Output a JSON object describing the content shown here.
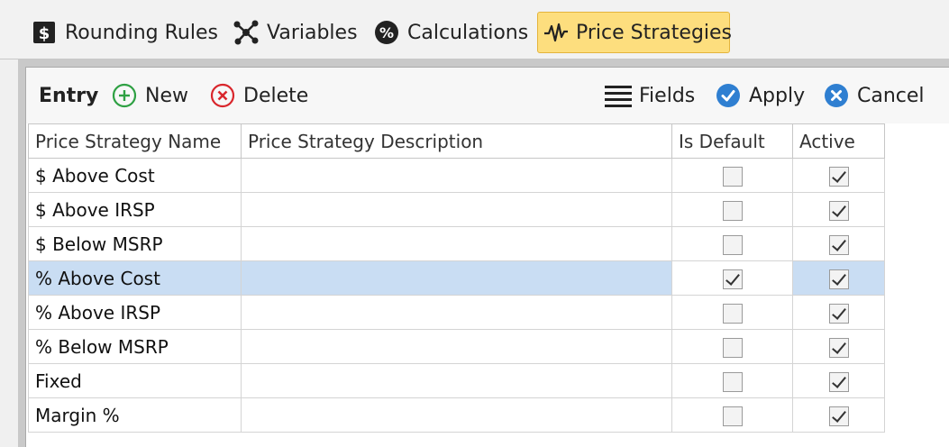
{
  "tabs": [
    {
      "label": "Rounding Rules",
      "icon": "dollar-sign-icon",
      "active": false
    },
    {
      "label": "Variables",
      "icon": "network-nodes-icon",
      "active": false
    },
    {
      "label": "Calculations",
      "icon": "percent-icon",
      "active": false
    },
    {
      "label": "Price Strategies",
      "icon": "pulse-wave-icon",
      "active": true
    }
  ],
  "toolbar": {
    "title": "Entry",
    "new_label": "New",
    "delete_label": "Delete",
    "fields_label": "Fields",
    "apply_label": "Apply",
    "cancel_label": "Cancel"
  },
  "grid": {
    "columns": [
      "Price Strategy Name",
      "Price Strategy Description",
      "Is Default",
      "Active"
    ],
    "rows": [
      {
        "name": "$ Above Cost",
        "description": "",
        "is_default": false,
        "active": true
      },
      {
        "name": "$ Above IRSP",
        "description": "",
        "is_default": false,
        "active": true
      },
      {
        "name": "$ Below MSRP",
        "description": "",
        "is_default": false,
        "active": true
      },
      {
        "name": "% Above Cost",
        "description": "",
        "is_default": true,
        "active": true,
        "selected": true
      },
      {
        "name": "% Above IRSP",
        "description": "",
        "is_default": false,
        "active": true
      },
      {
        "name": "% Below MSRP",
        "description": "",
        "is_default": false,
        "active": true
      },
      {
        "name": "Fixed",
        "description": "",
        "is_default": false,
        "active": true
      },
      {
        "name": "Margin %",
        "description": "",
        "is_default": false,
        "active": true
      }
    ]
  },
  "colors": {
    "active_tab_bg": "#fdde7e",
    "selected_row_bg": "#c9ddf3",
    "new_green": "#2ea043",
    "delete_red": "#d9262c",
    "apply_blue": "#2f7fd1"
  }
}
